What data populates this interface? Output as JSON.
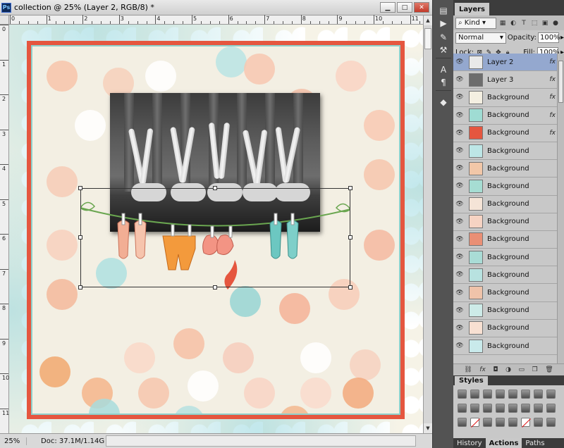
{
  "document": {
    "title": "collection @ 25% (Layer 2, RGB/8) *",
    "zoom": "25%",
    "doc_info": "Doc: 37.1M/1.14G",
    "ruler_top": [
      "0",
      "1",
      "2",
      "3",
      "4",
      "5",
      "6",
      "7",
      "8",
      "9",
      "10",
      "11"
    ],
    "ruler_left": [
      "0",
      "1",
      "2",
      "3",
      "4",
      "5",
      "6",
      "7",
      "8",
      "9",
      "10",
      "11"
    ],
    "colors": {
      "frame_red": "#e5563f",
      "frame_teal": "#8ed0cb",
      "paper": "#f3efe3"
    }
  },
  "window_controls": {
    "minimize": "▁",
    "maximize": "□",
    "close": "✕"
  },
  "dock_icons": [
    "history-icon",
    "actions-icon",
    "brush-icon",
    "tool-presets-icon",
    "character-icon",
    "paragraph-icon",
    "3d-icon"
  ],
  "layers_panel": {
    "tab_label": "Layers",
    "kind_filter": "Kind",
    "blend_mode": "Normal",
    "opacity_label": "Opacity:",
    "opacity_value": "100%",
    "lock_label": "Lock:",
    "fill_label": "Fill:",
    "fill_value": "100%",
    "layers": [
      {
        "name": "Layer 2",
        "fx": "fx",
        "selected": true,
        "thumb": "#e9e9e9"
      },
      {
        "name": "Layer 3",
        "fx": "fx",
        "selected": false,
        "thumb": "#6d6d6d"
      },
      {
        "name": "Background",
        "fx": "fx",
        "selected": false,
        "thumb": "#f4efe1"
      },
      {
        "name": "Background",
        "fx": "fx",
        "selected": false,
        "thumb": "#9fdcd3"
      },
      {
        "name": "Background",
        "fx": "fx",
        "selected": false,
        "thumb": "#e5563f"
      },
      {
        "name": "Background",
        "fx": "",
        "selected": false,
        "thumb": "#bde6e6"
      },
      {
        "name": "Background",
        "fx": "",
        "selected": false,
        "thumb": "#f2c7a8"
      },
      {
        "name": "Background",
        "fx": "",
        "selected": false,
        "thumb": "#a6ddd3"
      },
      {
        "name": "Background",
        "fx": "",
        "selected": false,
        "thumb": "#f5e4d7"
      },
      {
        "name": "Background",
        "fx": "",
        "selected": false,
        "thumb": "#f6d3c3"
      },
      {
        "name": "Background",
        "fx": "",
        "selected": false,
        "thumb": "#ea8f75"
      },
      {
        "name": "Background",
        "fx": "",
        "selected": false,
        "thumb": "#a9dcd6"
      },
      {
        "name": "Background",
        "fx": "",
        "selected": false,
        "thumb": "#b8e2e0"
      },
      {
        "name": "Background",
        "fx": "",
        "selected": false,
        "thumb": "#efc3aa"
      },
      {
        "name": "Background",
        "fx": "",
        "selected": false,
        "thumb": "#cdebe8"
      },
      {
        "name": "Background",
        "fx": "",
        "selected": false,
        "thumb": "#f8e0d2"
      },
      {
        "name": "Background",
        "fx": "",
        "selected": false,
        "thumb": "#c9eaeb"
      }
    ],
    "bottom_icons": [
      "link-icon",
      "fx-icon",
      "mask-icon",
      "adjustment-icon",
      "group-icon",
      "new-layer-icon",
      "trash-icon"
    ]
  },
  "styles_panel": {
    "tab_label": "Styles"
  },
  "bottom_tabs": [
    "History",
    "Actions",
    "Paths"
  ]
}
